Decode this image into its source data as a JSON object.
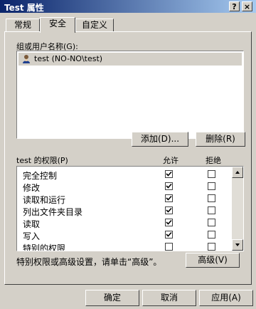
{
  "window": {
    "title": "Test 属性",
    "help_label": "?",
    "close_label": "×"
  },
  "tabs": [
    {
      "label": "常规",
      "active": false
    },
    {
      "label": "安全",
      "active": true
    },
    {
      "label": "自定义",
      "active": false
    }
  ],
  "users": {
    "label": "组或用户名称(G):",
    "items": [
      {
        "name": "test (NO-NO\\test)",
        "icon": "user-icon",
        "selected": true
      }
    ],
    "add_label": "添加(D)...",
    "remove_label": "删除(R)"
  },
  "permissions": {
    "label": "test 的权限(P)",
    "allow_label": "允许",
    "deny_label": "拒绝",
    "rows": [
      {
        "name": "完全控制",
        "allow": true,
        "deny": false
      },
      {
        "name": "修改",
        "allow": true,
        "deny": false
      },
      {
        "name": "读取和运行",
        "allow": true,
        "deny": false
      },
      {
        "name": "列出文件夹目录",
        "allow": true,
        "deny": false
      },
      {
        "name": "读取",
        "allow": true,
        "deny": false
      },
      {
        "name": "写入",
        "allow": true,
        "deny": false
      },
      {
        "name": "特别的权限",
        "allow": false,
        "deny": false
      }
    ]
  },
  "advanced": {
    "note": "特别权限或高级设置，请单击“高级”。",
    "button_label": "高级(V)"
  },
  "footer": {
    "ok_label": "确定",
    "cancel_label": "取消",
    "apply_label": "应用(A)"
  }
}
